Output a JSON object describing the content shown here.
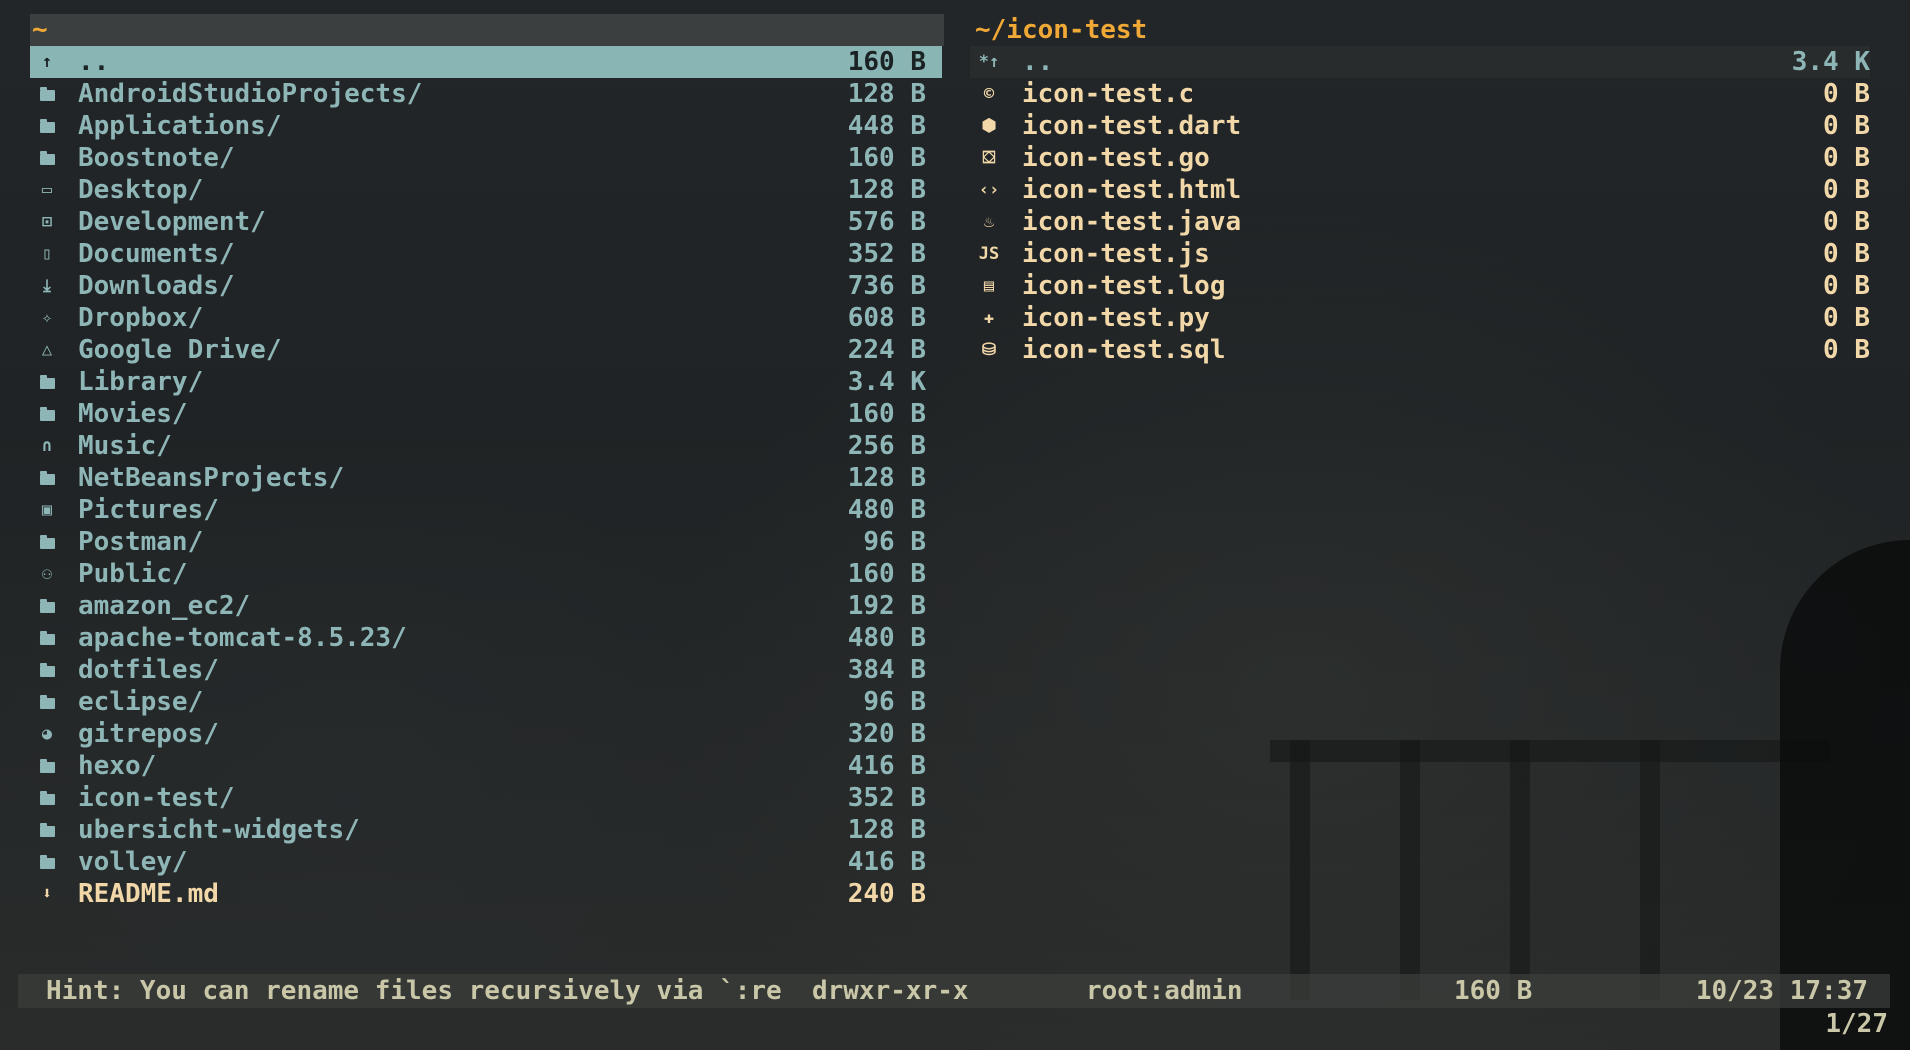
{
  "left_pane": {
    "path": "~",
    "entries": [
      {
        "icon": "arrow-up-icon",
        "glyph": "↑",
        "name": "..",
        "size": "160 B",
        "selected": true
      },
      {
        "icon": "folder-icon",
        "name": "AndroidStudioProjects/",
        "size": "128 B"
      },
      {
        "icon": "folder-icon",
        "name": "Applications/",
        "size": "448 B"
      },
      {
        "icon": "folder-icon",
        "name": "Boostnote/",
        "size": "160 B"
      },
      {
        "icon": "monitor-icon",
        "glyph": "▭",
        "name": "Desktop/",
        "size": "128 B"
      },
      {
        "icon": "terminal-icon",
        "glyph": "⊡",
        "name": "Development/",
        "size": "576 B"
      },
      {
        "icon": "document-icon",
        "glyph": "▯",
        "name": "Documents/",
        "size": "352 B"
      },
      {
        "icon": "download-icon",
        "glyph": "⤓",
        "name": "Downloads/",
        "size": "736 B"
      },
      {
        "icon": "dropbox-icon",
        "glyph": "✧",
        "name": "Dropbox/",
        "size": "608 B"
      },
      {
        "icon": "google-drive-icon",
        "glyph": "△",
        "name": "Google Drive/",
        "size": "224 B"
      },
      {
        "icon": "folder-icon",
        "name": "Library/",
        "size": "3.4 K"
      },
      {
        "icon": "folder-icon",
        "name": "Movies/",
        "size": "160 B"
      },
      {
        "icon": "headphones-icon",
        "glyph": "∩",
        "name": "Music/",
        "size": "256 B"
      },
      {
        "icon": "folder-icon",
        "name": "NetBeansProjects/",
        "size": "128 B"
      },
      {
        "icon": "picture-icon",
        "glyph": "▣",
        "name": "Pictures/",
        "size": "480 B"
      },
      {
        "icon": "folder-icon",
        "name": "Postman/",
        "size": "96 B"
      },
      {
        "icon": "people-icon",
        "glyph": "⚇",
        "name": "Public/",
        "size": "160 B"
      },
      {
        "icon": "folder-icon",
        "name": "amazon_ec2/",
        "size": "192 B"
      },
      {
        "icon": "folder-icon",
        "name": "apache-tomcat-8.5.23/",
        "size": "480 B"
      },
      {
        "icon": "folder-icon",
        "name": "dotfiles/",
        "size": "384 B"
      },
      {
        "icon": "folder-icon",
        "name": "eclipse/",
        "size": "96 B"
      },
      {
        "icon": "github-icon",
        "glyph": "◕",
        "name": "gitrepos/",
        "size": "320 B"
      },
      {
        "icon": "folder-icon",
        "name": "hexo/",
        "size": "416 B"
      },
      {
        "icon": "folder-icon",
        "name": "icon-test/",
        "size": "352 B"
      },
      {
        "icon": "folder-icon",
        "name": "ubersicht-widgets/",
        "size": "128 B"
      },
      {
        "icon": "folder-icon",
        "name": "volley/",
        "size": "416 B"
      },
      {
        "icon": "markdown-icon",
        "glyph": "⬇",
        "name": "README.md",
        "size": "240 B",
        "file": true
      }
    ]
  },
  "right_pane": {
    "path": "~/icon-test",
    "entries": [
      {
        "icon": "parent-dir-icon",
        "glyph": "*↑",
        "name": "..",
        "size": "3.4 K",
        "parent": true
      },
      {
        "icon": "c-lang-icon",
        "glyph": "©",
        "name": "icon-test.c",
        "size": "0 B"
      },
      {
        "icon": "dart-icon",
        "glyph": "⬢",
        "name": "icon-test.dart",
        "size": "0 B"
      },
      {
        "icon": "go-gopher-icon",
        "glyph": "⛋",
        "name": "icon-test.go",
        "size": "0 B"
      },
      {
        "icon": "html-icon",
        "glyph": "‹›",
        "name": "icon-test.html",
        "size": "0 B"
      },
      {
        "icon": "java-icon",
        "glyph": "♨",
        "name": "icon-test.java",
        "size": "0 B"
      },
      {
        "icon": "javascript-icon",
        "glyph": "JS",
        "name": "icon-test.js",
        "size": "0 B"
      },
      {
        "icon": "log-icon",
        "glyph": "▤",
        "name": "icon-test.log",
        "size": "0 B"
      },
      {
        "icon": "python-icon",
        "glyph": "✚",
        "name": "icon-test.py",
        "size": "0 B"
      },
      {
        "icon": "database-icon",
        "glyph": "⛁",
        "name": "icon-test.sql",
        "size": "0 B"
      }
    ]
  },
  "status_bar": {
    "hint": "Hint: You can rename files recursively via `:re",
    "permissions": "drwxr-xr-x",
    "owner": "root:admin",
    "size": "160 B",
    "modified": "10/23 17:37"
  },
  "position": "1/27",
  "colors": {
    "directory": "#8fb6b6",
    "file": "#f2d8a8",
    "path_header": "#f0a836",
    "selection_bg": "#89b5b5",
    "status_text": "#c9c7a8"
  }
}
